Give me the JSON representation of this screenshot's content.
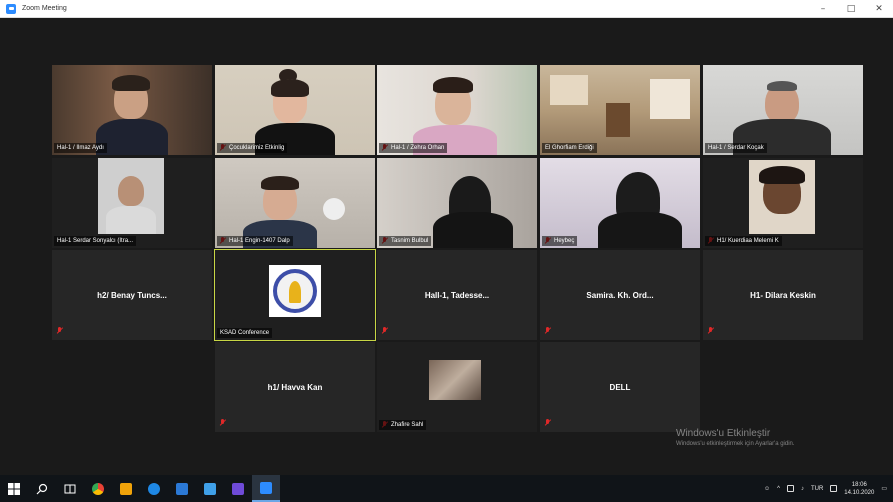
{
  "window": {
    "title": "Zoom Meeting",
    "controls": [
      "–",
      "□",
      "✕"
    ]
  },
  "participants": [
    {
      "id": "p1",
      "name": "Hal-1 / Ilmaz Aydı",
      "video": true,
      "muted": false
    },
    {
      "id": "p2",
      "name": "Çocuklarimiz Etkinlig",
      "video": true,
      "muted": true
    },
    {
      "id": "p3",
      "name": "Hal-1 / Zehra Orhan",
      "video": true,
      "muted": true
    },
    {
      "id": "p4",
      "name": "El Ghorfiam Erdiği",
      "video": true,
      "muted": false
    },
    {
      "id": "p5",
      "name": "Hal-1 / Serdar Koçak",
      "video": true,
      "muted": false
    },
    {
      "id": "p6",
      "name": "Hal-1 Serdar Sonyalcı (Itra...",
      "video": true,
      "muted": false
    },
    {
      "id": "p7",
      "name": "Hal-1 Engin-1407 Dalp",
      "video": true,
      "muted": true
    },
    {
      "id": "p8",
      "name": "Tasnim Bulbul",
      "video": true,
      "muted": true
    },
    {
      "id": "p9",
      "name": "Heybeç",
      "video": true,
      "muted": true
    },
    {
      "id": "p10",
      "name": "H1/ Kuerdiaa Melemi K",
      "video": true,
      "muted": true
    },
    {
      "id": "p11",
      "name": "h2/ Benay Tuncs...",
      "video": false,
      "muted": true
    },
    {
      "id": "p12",
      "name": "KSAD Conference",
      "video": true,
      "muted": false,
      "active_speaker": true
    },
    {
      "id": "p13",
      "name": "Hall-1, Tadesse...",
      "video": false,
      "muted": true
    },
    {
      "id": "p14",
      "name": "Samira. Kh. Ord...",
      "video": false,
      "muted": true
    },
    {
      "id": "p15",
      "name": "H1- Dilara Keskin",
      "video": false,
      "muted": true
    },
    {
      "id": "p16",
      "name": "h1/ Havva Kan",
      "video": false,
      "muted": true
    },
    {
      "id": "p17",
      "name": "Zhafire Sahl",
      "video": true,
      "muted": true
    },
    {
      "id": "p18",
      "name": "DELL",
      "video": false,
      "muted": true
    }
  ],
  "watermark": {
    "title": "Windows'u Etkinleştir",
    "subtitle": "Windows'u etkinleştirmek için Ayarlar'a gidin."
  },
  "taskbar": {
    "icons": [
      "windows-start-icon",
      "search-icon",
      "task-view-icon",
      "chrome-icon",
      "store-icon",
      "edge-icon",
      "mail-icon",
      "files-icon",
      "photos-icon",
      "zoom-icon"
    ],
    "tray_lang": "TUR",
    "clock_time": "18:06",
    "clock_date": "14.10.2020"
  },
  "colors": {
    "active_speaker_border": "#c8d645",
    "mute_icon": "#e02828",
    "background": "#1a1a1a"
  }
}
